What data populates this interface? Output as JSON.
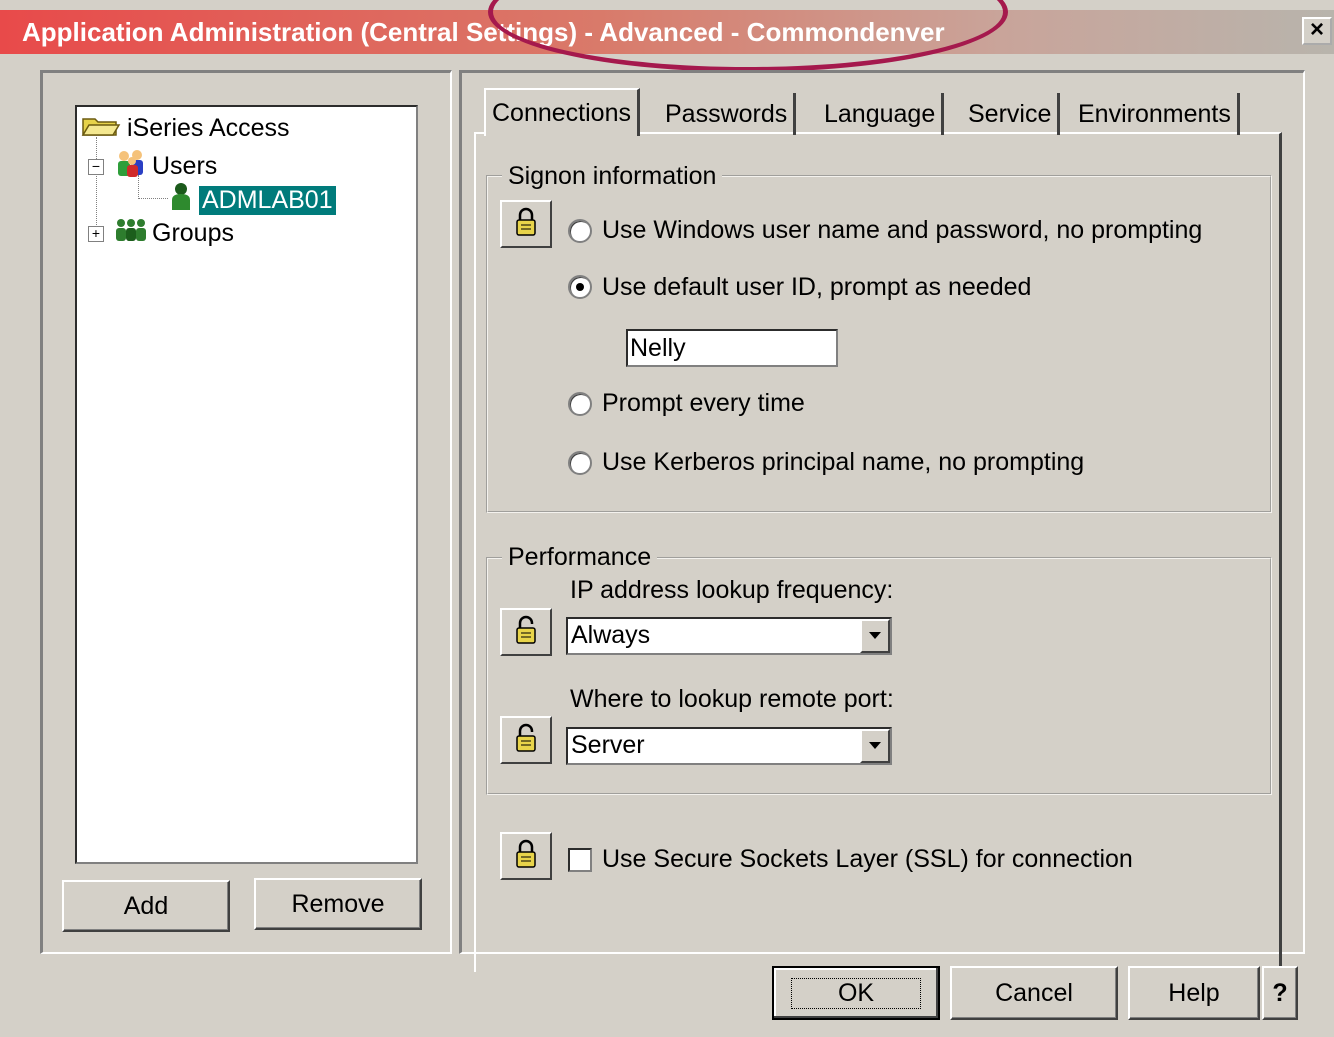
{
  "window": {
    "title": "Application Administration (Central Settings) - Advanced - Commondenver",
    "close_label": "×"
  },
  "tree": {
    "root": "iSeries Access",
    "users": "Users",
    "selected_user": "ADMLAB01",
    "groups": "Groups"
  },
  "left_buttons": {
    "add": "Add",
    "remove": "Remove"
  },
  "tabs": [
    "Connections",
    "Passwords",
    "Language",
    "Service",
    "Environments"
  ],
  "active_tab": "Connections",
  "signon": {
    "label": "Signon information",
    "options": [
      "Use Windows user name and password, no prompting",
      "Use default user ID, prompt as needed",
      "Prompt every time",
      "Use Kerberos principal name, no prompting"
    ],
    "selected_option": "Use default user ID, prompt as needed",
    "default_user_id": "Nelly"
  },
  "performance": {
    "label": "Performance",
    "ip_lookup_label": "IP address lookup frequency:",
    "ip_lookup_value": "Always",
    "remote_port_label": "Where to lookup remote port:",
    "remote_port_value": "Server"
  },
  "ssl": {
    "label": "Use Secure Sockets Layer (SSL) for connection",
    "checked": false
  },
  "dialog_buttons": {
    "ok": "OK",
    "cancel": "Cancel",
    "help": "Help",
    "whats_this": "?"
  },
  "icons": {
    "folder": "folder-icon",
    "users": "users-icon",
    "user": "user-icon",
    "groups": "groups-icon",
    "lock_closed": "lock-closed-icon",
    "lock_open": "lock-open-icon",
    "dropdown": "chevron-down-icon"
  },
  "colors": {
    "titlebar_start": "#e84a4a",
    "titlebar_end": "#b8b4ac",
    "highlight_circle": "#a5194d",
    "selection": "#007b7b",
    "dialog_bg": "#d4d0c8"
  }
}
